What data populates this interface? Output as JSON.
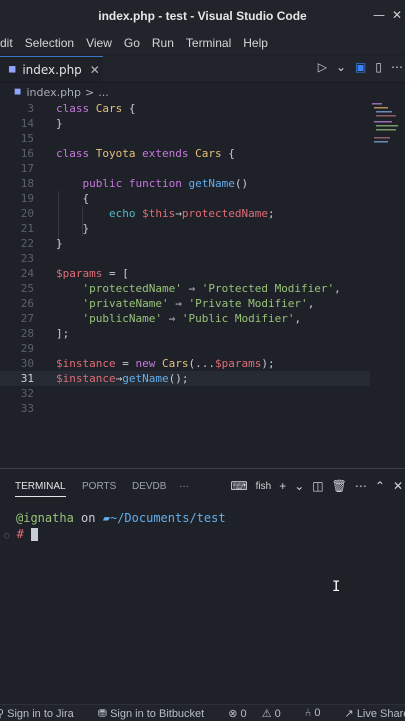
{
  "window": {
    "title": "index.php - test - Visual Studio Code"
  },
  "menu": [
    "Edit",
    "Selection",
    "View",
    "Go",
    "Run",
    "Terminal",
    "Help"
  ],
  "tab": {
    "label": "index.php",
    "icon": "php-icon",
    "close": "✕"
  },
  "breadcrumb": {
    "file": "index.php",
    "sep": ">",
    "more": "..."
  },
  "editor": {
    "lines": [
      {
        "n": "3",
        "code": "class Cars {"
      },
      {
        "n": "14",
        "code": "}"
      },
      {
        "n": "15",
        "code": ""
      },
      {
        "n": "16",
        "code": "class Toyota extends Cars {"
      },
      {
        "n": "17",
        "code": ""
      },
      {
        "n": "18",
        "code": "    public function getName()"
      },
      {
        "n": "19",
        "code": "    {"
      },
      {
        "n": "20",
        "code": "        echo $this→protectedName;"
      },
      {
        "n": "21",
        "code": "    }"
      },
      {
        "n": "22",
        "code": "}"
      },
      {
        "n": "23",
        "code": ""
      },
      {
        "n": "24",
        "code": "$params = ["
      },
      {
        "n": "25",
        "code": "    'protectedName' ⇒ 'Protected Modifier',"
      },
      {
        "n": "26",
        "code": "    'privateName' ⇒ 'Private Modifier',"
      },
      {
        "n": "27",
        "code": "    'publicName' ⇒ 'Public Modifier',"
      },
      {
        "n": "28",
        "code": "];"
      },
      {
        "n": "29",
        "code": ""
      },
      {
        "n": "30",
        "code": "$instance = new Cars(...$params);"
      },
      {
        "n": "31",
        "code": "$instance→getName();"
      },
      {
        "n": "32",
        "code": ""
      },
      {
        "n": "33",
        "code": ""
      }
    ]
  },
  "panel": {
    "tabs": [
      "TERMINAL",
      "PORTS",
      "DEVDB",
      "···"
    ],
    "shell": "fish"
  },
  "terminal": {
    "user": "ignatha",
    "on": "on",
    "path": "~/Documents/test",
    "prompt": "#"
  },
  "status": {
    "jira": "Sign in to Jira",
    "bitbucket": "Sign in to Bitbucket",
    "errors": "0",
    "warnings": "0",
    "ports": "0",
    "liveshare": "Live Share"
  },
  "colors": {
    "accent": "#3a78c2",
    "keyword": "#c678dd",
    "class": "#e5c07b",
    "function": "#61afef",
    "variable": "#e06c75",
    "string": "#98c379"
  }
}
